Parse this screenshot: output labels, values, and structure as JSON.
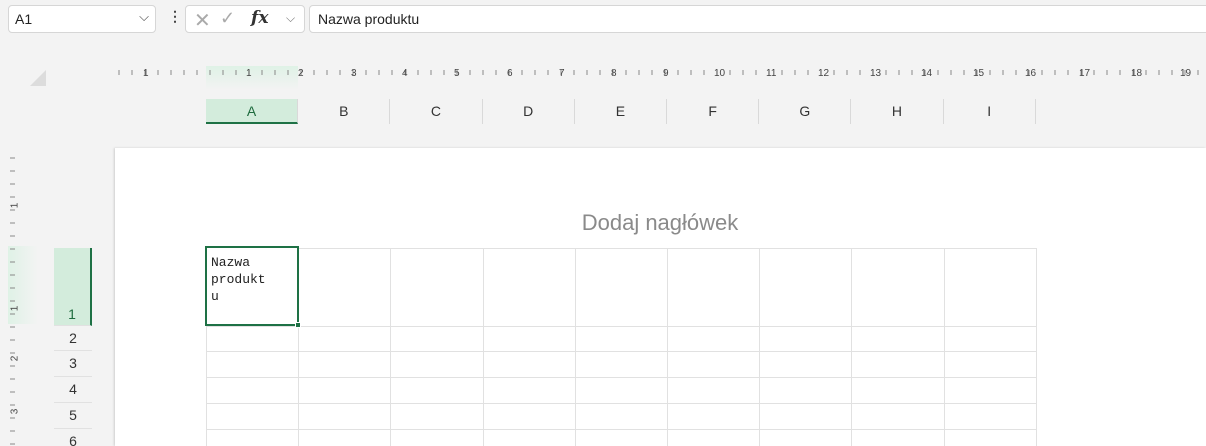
{
  "formula_bar": {
    "name_box": "A1",
    "formula": "Nazwa produktu"
  },
  "ruler": {
    "marks": [
      "1",
      "1",
      "2",
      "3",
      "4",
      "5",
      "6",
      "7",
      "8",
      "9",
      "10",
      "11",
      "12",
      "13",
      "14",
      "15",
      "16",
      "17",
      "18",
      "19"
    ],
    "vertical_marks": [
      "1",
      "1",
      "2",
      "3"
    ]
  },
  "columns": [
    "A",
    "B",
    "C",
    "D",
    "E",
    "F",
    "G",
    "H",
    "I"
  ],
  "rows": [
    "1",
    "2",
    "3",
    "4",
    "5",
    "6"
  ],
  "page": {
    "header_placeholder": "Dodaj nagłówek"
  },
  "active_cell": {
    "ref": "A1",
    "display_text": "Nazwa\nprodukt\nu"
  },
  "colors": {
    "accent": "#1e7145",
    "selection_fill": "#d3ecdc"
  },
  "icons": [
    "chevron-down-icon",
    "more-options-icon",
    "cancel-icon",
    "enter-icon",
    "function-icon"
  ]
}
